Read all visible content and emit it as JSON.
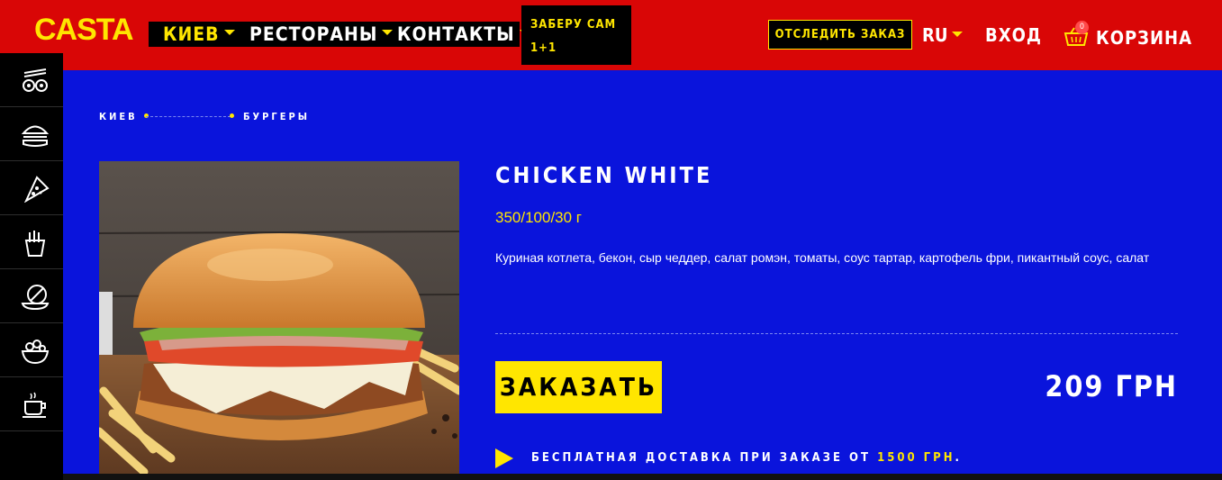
{
  "header": {
    "logo": "CASTA",
    "nav": [
      {
        "label": "КИЕВ"
      },
      {
        "label": "РЕСТОРАНЫ"
      },
      {
        "label": "КОНТАКТЫ"
      }
    ],
    "promo_line1": "ЗАБЕРУ САМ",
    "promo_line2": "1+1",
    "track_order": "ОТСЛЕДИТЬ ЗАКАЗ",
    "language": "RU",
    "login": "ВХОД",
    "cart_count": "0",
    "cart_label": "КОРЗИНА"
  },
  "sidebar": {
    "items": [
      {
        "icon": "sushi-icon"
      },
      {
        "icon": "burger-icon"
      },
      {
        "icon": "pizza-icon"
      },
      {
        "icon": "fries-icon"
      },
      {
        "icon": "hot-dish-icon"
      },
      {
        "icon": "salad-icon"
      },
      {
        "icon": "coffee-cup-icon"
      }
    ]
  },
  "breadcrumb": {
    "city": "КИЕВ",
    "category": "БУРГЕРЫ"
  },
  "product": {
    "name": "CHICKEN WHITE",
    "weight": "350/100/30 г",
    "description": "Куриная котлета, бекон, сыр чеддер, салат ромэн, томаты, соус тартар, картофель фри, пикантный соус, салат",
    "order_label": "ЗАКАЗАТЬ",
    "price": "209 ГРН",
    "delivery_text": "БЕСПЛАТНАЯ ДОСТАВКА ПРИ ЗАКАЗЕ ОТ",
    "delivery_amount": "1500 ГРН",
    "delivery_end": "."
  },
  "colors": {
    "header_red": "#d90606",
    "page_blue": "#0a14dc",
    "accent_yellow": "#ffe600"
  }
}
